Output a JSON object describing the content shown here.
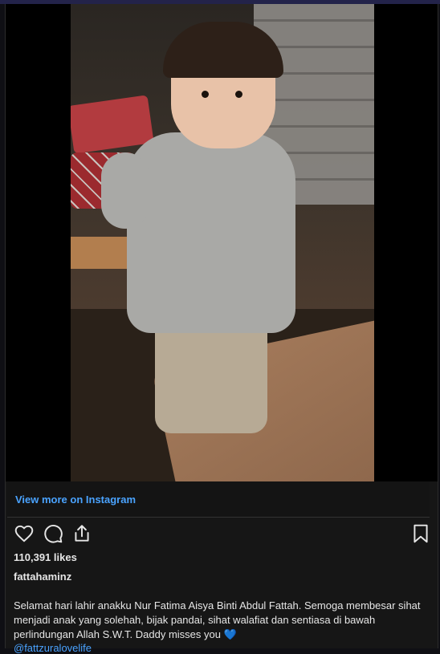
{
  "embed": {
    "view_more": "View more on Instagram",
    "likes": "110,391 likes",
    "username": "fattahaminz",
    "caption": "Selamat hari lahir anakku Nur Fatima Aisya Binti Abdul Fattah. Semoga membesar sihat menjadi anak yang solehah, bijak pandai, sihat walafiat dan sentiasa di bawah perlindungan Allah S.W.T. Daddy misses you",
    "caption_emoji": "💙",
    "mention": "@fattzuralovelife"
  },
  "icons": [
    "heart-icon",
    "comment-icon",
    "share-icon",
    "bookmark-icon"
  ],
  "colors": {
    "link": "#4aa3ff",
    "background": "#161616",
    "text": "#e6e6e6"
  }
}
